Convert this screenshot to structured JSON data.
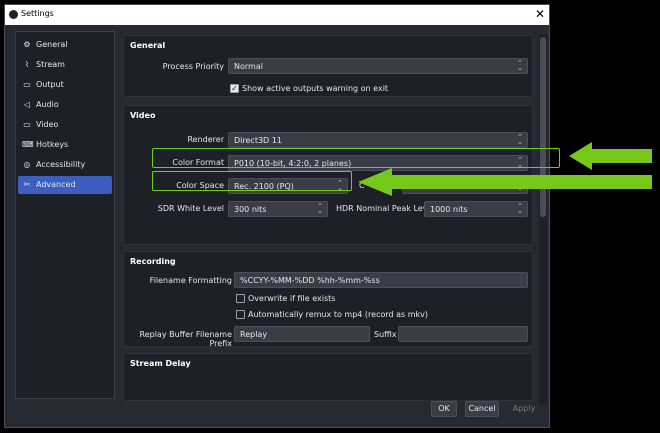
{
  "window": {
    "title": "Settings",
    "close_glyph": "✕"
  },
  "sidebar": {
    "items": [
      {
        "label": "General",
        "icon": "gear-icon",
        "glyph": "⚙"
      },
      {
        "label": "Stream",
        "icon": "antenna-icon",
        "glyph": "📡"
      },
      {
        "label": "Output",
        "icon": "output-icon",
        "glyph": "▭"
      },
      {
        "label": "Audio",
        "icon": "speaker-icon",
        "glyph": "🔈"
      },
      {
        "label": "Video",
        "icon": "monitor-icon",
        "glyph": "▭"
      },
      {
        "label": "Hotkeys",
        "icon": "keyboard-icon",
        "glyph": "⌨"
      },
      {
        "label": "Accessibility",
        "icon": "accessibility-icon",
        "glyph": "◎"
      },
      {
        "label": "Advanced",
        "icon": "wrench-icon",
        "glyph": "✂"
      }
    ],
    "active": "Advanced"
  },
  "general": {
    "title": "General",
    "process_priority_label": "Process Priority",
    "process_priority_value": "Normal",
    "show_warning_label": "Show active outputs warning on exit",
    "check_glyph": "✓"
  },
  "video": {
    "title": "Video",
    "renderer_label": "Renderer",
    "renderer_value": "Direct3D 11",
    "color_format_label": "Color Format",
    "color_format_value": "P010 (10-bit, 4:2:0, 2 planes)",
    "color_space_label": "Color Space",
    "color_space_value": "Rec. 2100 (PQ)",
    "color_range_label_partial": "C",
    "sdr_white_label": "SDR White Level",
    "sdr_white_value": "300 nits",
    "hdr_peak_label": "HDR Nominal Peak Level",
    "hdr_peak_value": "1000 nits"
  },
  "recording": {
    "title": "Recording",
    "filename_label": "Filename Formatting",
    "filename_value": "%CCYY-%MM-%DD %hh-%mm-%ss",
    "overwrite_label": "Overwrite if file exists",
    "remux_label": "Automatically remux to mp4 (record as mkv)",
    "replay_prefix_label": "Replay Buffer Filename Prefix",
    "replay_prefix_value": "Replay",
    "suffix_label": "Suffix",
    "suffix_value": ""
  },
  "stream_delay": {
    "title": "Stream Delay"
  },
  "buttons": {
    "ok": "OK",
    "cancel": "Cancel",
    "apply": "Apply"
  },
  "chevrons": {
    "up": "⌃",
    "down": "⌄"
  },
  "colors": {
    "highlight": "#6ed10f",
    "arrow": "#76c81a",
    "accent": "#3c5fbf"
  }
}
